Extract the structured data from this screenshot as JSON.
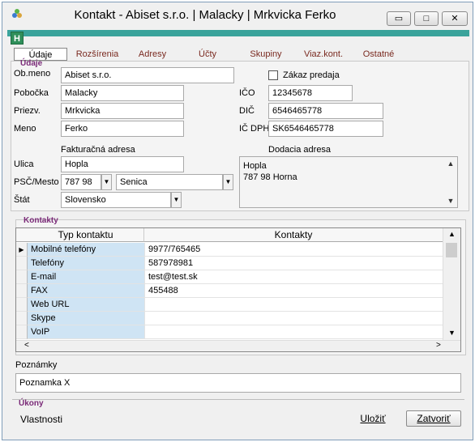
{
  "window": {
    "title": "Kontakt - Abiset s.r.o. | Malacky | Mrkvicka Ferko",
    "minimize_glyph": "▭",
    "maximize_glyph": "□",
    "close_glyph": "✕"
  },
  "toolbar": {
    "h_label": "H"
  },
  "tabs": [
    "Údaje",
    "Rozšírenia",
    "Adresy",
    "Účty",
    "Skupiny",
    "Viaz.kont.",
    "Ostatné"
  ],
  "udaje": {
    "group_title": "Údaje",
    "obmeno_label": "Ob.meno",
    "obmeno_value": "Abiset s.r.o.",
    "zakaz_label": "Zákaz predaja",
    "pobocka_label": "Pobočka",
    "pobocka_value": "Malacky",
    "ico_label": "IČO",
    "ico_value": "12345678",
    "priezv_label": "Priezv.",
    "priezv_value": "Mrkvicka",
    "dic_label": "DIČ",
    "dic_value": "6546465778",
    "meno_label": "Meno",
    "meno_value": "Ferko",
    "icdph_label": "IČ DPH",
    "icdph_value": "SK6546465778",
    "fakt_title": "Fakturačná adresa",
    "dod_title": "Dodacia adresa",
    "ulica_label": "Ulica",
    "ulica_value": "Hopla",
    "psc_label": "PSČ/Mesto",
    "psc_value": "787 98",
    "mesto_value": "Senica",
    "stat_label": "Štát",
    "stat_value": "Slovensko",
    "dodacia_line1": "Hopla",
    "dodacia_line2": "787 98 Horna"
  },
  "kontakty": {
    "group_title": "Kontakty",
    "col_type": "Typ kontaktu",
    "col_value": "Kontakty",
    "rows": [
      {
        "type": "Mobilné telefóny",
        "value": "9977/765465"
      },
      {
        "type": "Telefóny",
        "value": "587978981"
      },
      {
        "type": "E-mail",
        "value": "test@test.sk"
      },
      {
        "type": "FAX",
        "value": "455488"
      },
      {
        "type": "Web URL",
        "value": ""
      },
      {
        "type": "Skype",
        "value": ""
      },
      {
        "type": "VoIP",
        "value": ""
      }
    ]
  },
  "poznamky": {
    "label": "Poznámky",
    "value": "Poznamka X"
  },
  "ukony": {
    "title": "Úkony",
    "vlastnosti": "Vlastnosti",
    "ulozit": "Uložiť",
    "zatvorit": "Zatvoriť"
  }
}
